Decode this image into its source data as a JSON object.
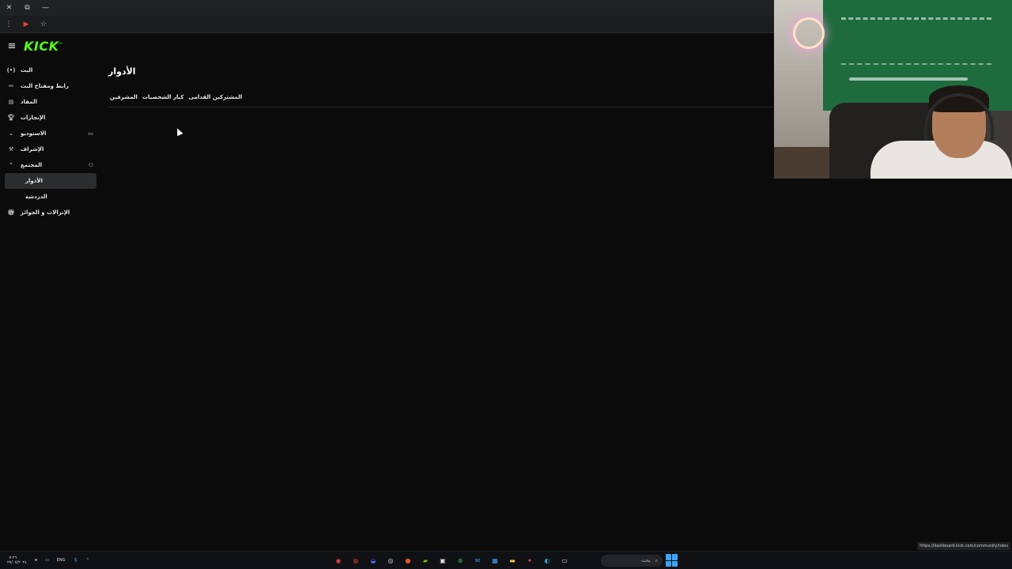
{
  "browser": {
    "window_controls": [
      {
        "name": "close",
        "glyph": "✕"
      },
      {
        "name": "restore",
        "glyph": "⧉"
      },
      {
        "name": "minimize",
        "glyph": "—"
      }
    ],
    "toolbar": [
      {
        "name": "menu",
        "glyph": "⋮"
      },
      {
        "name": "extension",
        "glyph": "▶"
      },
      {
        "name": "bookmark",
        "glyph": "☆"
      }
    ],
    "status_url": "https://dashboard.kick.com/community/roles"
  },
  "app": {
    "logo": "KICK",
    "logo_mark": "™",
    "hamburger": "≡"
  },
  "sidebar": {
    "items": [
      {
        "label": "البث",
        "icon": "(•)",
        "icon_name": "broadcast-icon"
      },
      {
        "label": "رابط ومفتاح البث",
        "icon": "⚯",
        "icon_name": "link-icon"
      },
      {
        "label": "المقاد",
        "icon": "▤",
        "icon_name": "panel-icon"
      },
      {
        "label": "الإنجازات",
        "icon": "🏆︎",
        "icon_name": "trophy-icon"
      },
      {
        "label": "الاستوديو",
        "icon": "⌄",
        "icon_name": "chevron-down-icon",
        "right_icon": "▭",
        "right_icon_name": "studio-icon"
      },
      {
        "label": "الإشراف",
        "icon": "⚒",
        "icon_name": "moderation-icon"
      },
      {
        "label": "المجتمع",
        "icon": "⌃",
        "icon_name": "chevron-up-icon",
        "right_icon": "⚇",
        "right_icon_name": "community-icon"
      }
    ],
    "sub_items": [
      {
        "label": "الأدوار",
        "active": true
      },
      {
        "label": "الدردشة",
        "active": false
      }
    ],
    "last_item": {
      "label": "الإنزالات و الجوائز",
      "icon": "🎁︎",
      "icon_name": "gift-icon"
    }
  },
  "main": {
    "title": "الأدوار",
    "tabs": [
      "المشرفين",
      "كبار الشخصيات",
      "المشتركين القدامى"
    ]
  },
  "taskbar": {
    "clock_time": "٠٧:٢٦",
    "clock_date": "٢٧/٠٧/٢٠٢٤",
    "language": "ENG",
    "search_placeholder": "بحث",
    "apps": [
      {
        "name": "chrome",
        "glyph": "◉",
        "color": "#e8453c"
      },
      {
        "name": "app-red",
        "glyph": "◍",
        "color": "#d6402c"
      },
      {
        "name": "discord",
        "glyph": "◒",
        "color": "#5865f2"
      },
      {
        "name": "obs",
        "glyph": "◎",
        "color": "#e0e0e0"
      },
      {
        "name": "app-orange",
        "glyph": "●",
        "color": "#e65a2a"
      },
      {
        "name": "nvidia",
        "glyph": "▰",
        "color": "#76b900"
      },
      {
        "name": "terminal",
        "glyph": "▣",
        "color": "#dcdcdc"
      },
      {
        "name": "xbox",
        "glyph": "⊗",
        "color": "#2fb24c"
      },
      {
        "name": "mail",
        "glyph": "✉",
        "color": "#3a8dde"
      },
      {
        "name": "store",
        "glyph": "▦",
        "color": "#3da2ff"
      },
      {
        "name": "folder",
        "glyph": "▬",
        "color": "#f0c24a"
      },
      {
        "name": "app-multi",
        "glyph": "✦",
        "color": "#d9534f"
      },
      {
        "name": "edge",
        "glyph": "◐",
        "color": "#2aa6d8"
      },
      {
        "name": "window",
        "glyph": "▭",
        "color": "#cfcfcf"
      }
    ]
  },
  "colors": {
    "brand": "#53fc18",
    "background": "#0b0b0b",
    "sidebar_active": "#2a2c2e"
  }
}
